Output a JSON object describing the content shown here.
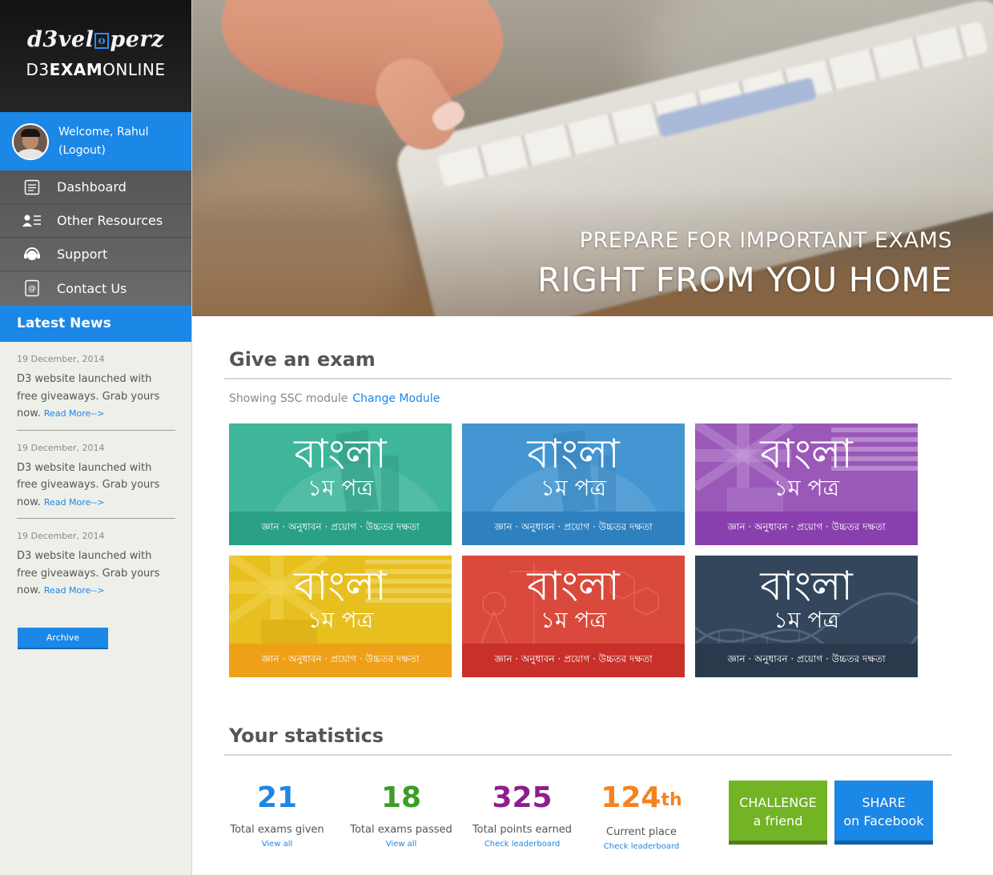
{
  "brand": {
    "logo_text": "d3vel",
    "logo_mark": "o",
    "logo_tail": "perz",
    "product_pre": "D3",
    "product_bold": "EXAM",
    "product_post": "ONLINE"
  },
  "user": {
    "welcome": "Welcome, Rahul",
    "logout": "(Logout)",
    "avatar_icon": "user-avatar"
  },
  "nav": [
    {
      "label": "Dashboard",
      "icon": "dashboard-icon"
    },
    {
      "label": "Other Resources",
      "icon": "resources-icon"
    },
    {
      "label": "Support",
      "icon": "support-headset-icon"
    },
    {
      "label": "Contact Us",
      "icon": "contact-card-icon"
    }
  ],
  "news": {
    "heading": "Latest News",
    "items": [
      {
        "date": "19 December, 2014",
        "text": "D3 website launched with free giveaways. Grab yours now.",
        "more": "Read More-->"
      },
      {
        "date": "19 December, 2014",
        "text": "D3 website launched with free giveaways. Grab yours now.",
        "more": "Read More-->"
      },
      {
        "date": "19 December, 2014",
        "text": "D3 website launched with free giveaways. Grab yours now.",
        "more": "Read More-->"
      }
    ],
    "archive": "Archive"
  },
  "hero": {
    "line1": "PREPARE FOR IMPORTANT EXAMS",
    "line2": "RIGHT FROM YOU HOME"
  },
  "exam": {
    "heading": "Give an exam",
    "showing": "Showing SSC module",
    "change": "Change Module",
    "cards": [
      {
        "title": "বাংলা",
        "sub": "১ম পত্র",
        "bar": "জ্ঞান · অনুধাবন · প্রয়োগ · উচ্চতর দক্ষতা",
        "color": "#3fb59a",
        "bar_color": "#2aa084"
      },
      {
        "title": "বাংলা",
        "sub": "১ম পত্র",
        "bar": "জ্ঞান · অনুধাবন · প্রয়োগ · উচ্চতর দক্ষতা",
        "color": "#4396d2",
        "bar_color": "#2f80bf"
      },
      {
        "title": "বাংলা",
        "sub": "১ম পত্র",
        "bar": "জ্ঞান · অনুধাবন · প্রয়োগ · উচ্চতর দক্ষতা",
        "color": "#9a58b8",
        "bar_color": "#8a3fae"
      },
      {
        "title": "বাংলা",
        "sub": "১ম পত্র",
        "bar": "জ্ঞান · অনুধাবন · প্রয়োগ · উচ্চতর দক্ষতা",
        "color": "#e7bf1f",
        "bar_color": "#eea018"
      },
      {
        "title": "বাংলা",
        "sub": "১ম পত্র",
        "bar": "জ্ঞান · অনুধাবন · প্রয়োগ · উচ্চতর দক্ষতা",
        "color": "#d9493c",
        "bar_color": "#c8302a"
      },
      {
        "title": "বাংলা",
        "sub": "১ম পত্র",
        "bar": "জ্ঞান · অনুধাবন · প্রয়োগ · উচ্চতর দক্ষতা",
        "color": "#33465b",
        "bar_color": "#2a3a4c"
      }
    ]
  },
  "stats": {
    "heading": "Your statistics",
    "items": [
      {
        "value": "21",
        "suffix": "",
        "label": "Total exams given",
        "link": "View all",
        "color": "#1b87e6"
      },
      {
        "value": "18",
        "suffix": "",
        "label": "Total exams passed",
        "link": "View all",
        "color": "#3d9d27"
      },
      {
        "value": "325",
        "suffix": "",
        "label": "Total points earned",
        "link": "Check leaderboard",
        "color": "#8e1e8e"
      },
      {
        "value": "124",
        "suffix": "th",
        "label": "Current place",
        "link": "Check leaderboard",
        "color": "#f58220"
      }
    ],
    "challenge": {
      "line1": "CHALLENGE",
      "line2": "a friend"
    },
    "share": {
      "line1": "SHARE",
      "line2": "on Facebook"
    }
  }
}
